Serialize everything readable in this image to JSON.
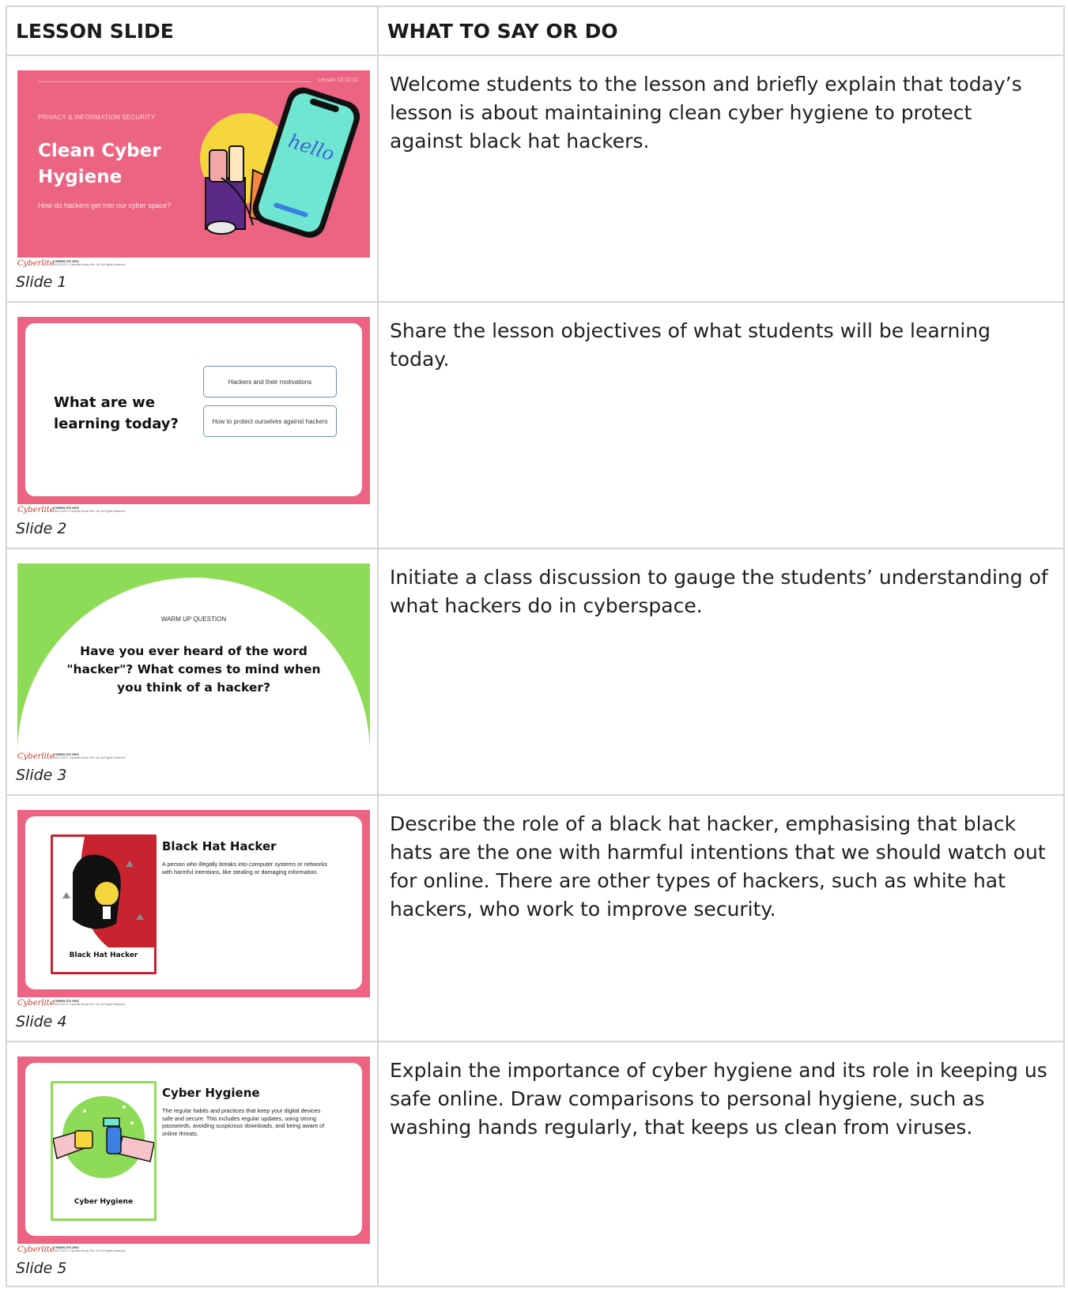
{
  "header": {
    "col1": "LESSON SLIDE",
    "col2": "WHAT TO SAY OR DO"
  },
  "footer": {
    "logo": "Cyberlite",
    "site": "CYBERLITE.ORG",
    "copyright": "2023-2024 © Cyberlite Books Pte. Ltd. All Rights Reserved."
  },
  "rows": [
    {
      "caption": "Slide 1",
      "instruction": "Welcome students to the lesson and briefly explain that today’s lesson is about maintaining clean cyber hygiene to protect against black hat hackers.",
      "slide": {
        "lesson_code": "Lesson 10.02.01",
        "kicker": "PRIVACY & INFORMATION SECURITY",
        "title": "Clean Cyber Hygiene",
        "subtitle": "How do hackers get into our cyber space?",
        "phone_text": "hello"
      }
    },
    {
      "caption": "Slide 2",
      "instruction": "Share the lesson objectives of what students will be learning today.",
      "slide": {
        "question": "What are we learning today?",
        "objectives": [
          "Hackers and their motivations",
          "How to protect ourselves against hackers"
        ]
      }
    },
    {
      "caption": "Slide 3",
      "instruction": "Initiate a class discussion to gauge the students’ understanding of what hackers do in cyberspace.",
      "slide": {
        "kicker": "WARM UP QUESTION",
        "question": "Have you ever heard of the word \"hacker\"? What comes to mind when you think of a hacker?"
      }
    },
    {
      "caption": "Slide 4",
      "instruction": "Describe the role of a black hat hacker, emphasising that black hats are the one with harmful intentions that we should watch out for online. There are other types of hackers, such as white hat hackers, who work to improve security.",
      "slide": {
        "heading": "Black Hat Hacker",
        "description": "A person who illegally breaks into computer systems or networks with harmful intentions, like stealing or damaging information.",
        "card_label": "Black Hat Hacker"
      }
    },
    {
      "caption": "Slide 5",
      "instruction": "Explain the importance of cyber hygiene and its role in keeping us safe online. Draw comparisons to personal hygiene, such as washing hands regularly, that keeps us clean from viruses.",
      "slide": {
        "heading": "Cyber Hygiene",
        "description": "The regular habits and practices that keep your digital devices safe and secure. This includes regular updates, using strong passwords, avoiding suspicious downloads, and being aware of online threats.",
        "card_label": "Cyber Hygiene"
      }
    }
  ]
}
